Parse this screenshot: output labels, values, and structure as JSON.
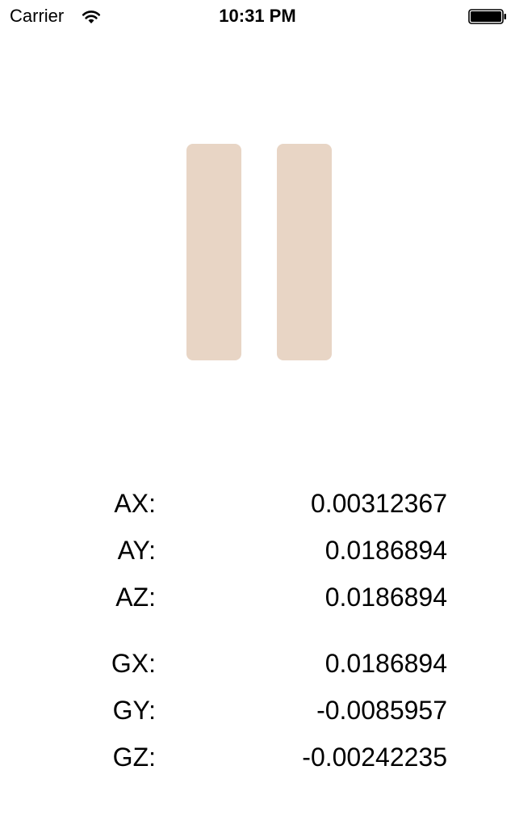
{
  "status_bar": {
    "carrier": "Carrier",
    "time": "10:31 PM",
    "wifi_icon": "wifi-icon",
    "battery_icon": "battery-full-icon"
  },
  "pause_button": {
    "icon": "pause-icon",
    "color": "#e8d5c5"
  },
  "accelerometer": [
    {
      "label": "AX:",
      "value": "0.00312367"
    },
    {
      "label": "AY:",
      "value": "0.0186894"
    },
    {
      "label": "AZ:",
      "value": "0.0186894"
    }
  ],
  "gyroscope": [
    {
      "label": "GX:",
      "value": "0.0186894"
    },
    {
      "label": "GY:",
      "value": "-0.0085957"
    },
    {
      "label": "GZ:",
      "value": "-0.00242235"
    }
  ]
}
